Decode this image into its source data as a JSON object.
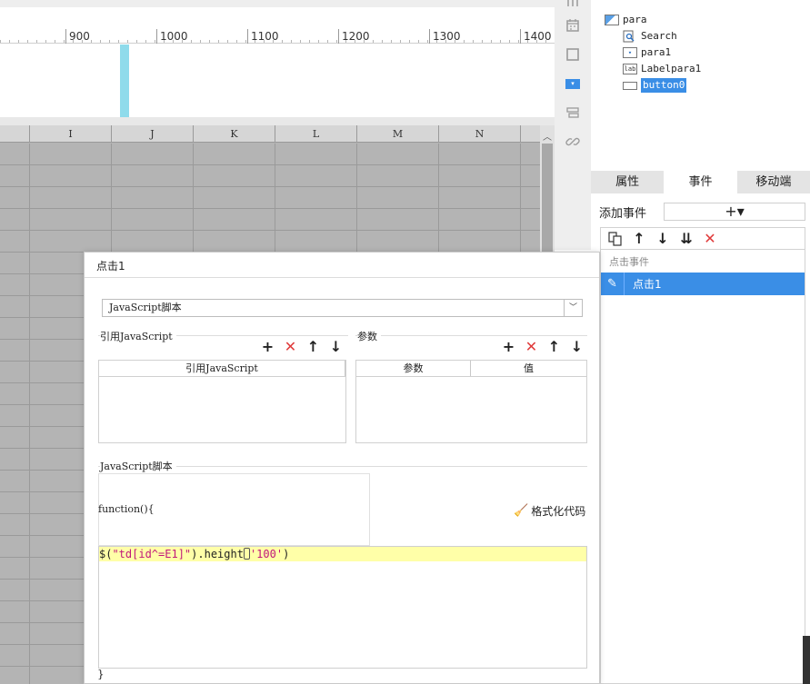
{
  "ruler": {
    "labels": [
      "900",
      "1000",
      "1100",
      "1200",
      "1300",
      "1400"
    ]
  },
  "sheet": {
    "columns": [
      "I",
      "J",
      "K",
      "L",
      "M",
      "N"
    ]
  },
  "tree": {
    "items": [
      {
        "label": "para",
        "icon": "form-panel-icon"
      },
      {
        "label": "Search",
        "icon": "search-widget-icon"
      },
      {
        "label": "para1",
        "icon": "dropdown-widget-icon"
      },
      {
        "label": "Labelpara1",
        "icon": "label-widget-icon",
        "icon_text": "lab"
      },
      {
        "label": "button0",
        "icon": "button-widget-icon",
        "selected": true
      }
    ]
  },
  "tabs": [
    "属性",
    "事件",
    "移动端"
  ],
  "active_tab": "事件",
  "events": {
    "add_label": "添加事件",
    "add_symbol": "+▾",
    "group_label": "点击事件",
    "items": [
      "点击1"
    ]
  },
  "dialog": {
    "title": "点击1",
    "script_type": "JavaScript脚本",
    "ref_js_section": "引用JavaScript",
    "params_section": "参数",
    "ref_js_header": "引用JavaScript",
    "params_headers": [
      "参数",
      "值"
    ],
    "script_section": "JavaScript脚本",
    "function_label": "function(){",
    "format_button": "格式化代码",
    "code": {
      "prefix": "$(",
      "selector": "\"td[id^=E1]\"",
      "middle": ").height",
      "argument": "'100'",
      "suffix": ")"
    },
    "closing": "}"
  },
  "colors": {
    "accent": "#3a8ee6",
    "delete_red": "#e03b3b",
    "code_highlight": "#ffffa8",
    "string_magenta": "#c0187a",
    "canvas_marker": "#8fdbeb"
  }
}
